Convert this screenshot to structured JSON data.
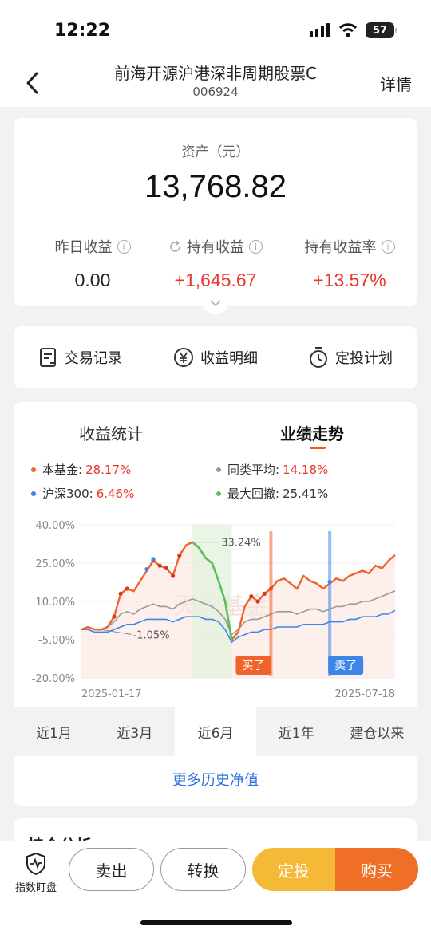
{
  "status_bar": {
    "time": "12:22",
    "battery": "57"
  },
  "header": {
    "title": "前海开源沪港深非周期股票C",
    "code": "006924",
    "detail": "详情"
  },
  "asset": {
    "label": "资产（元）",
    "amount": "13,768.82",
    "stats": [
      {
        "label": "昨日收益",
        "value": "0.00"
      },
      {
        "label": "持有收益",
        "value": "+1,645.67"
      },
      {
        "label": "持有收益率",
        "value": "+13.57%"
      }
    ]
  },
  "actions": [
    {
      "label": "交易记录",
      "icon": "record-icon"
    },
    {
      "label": "收益明细",
      "icon": "yen-icon"
    },
    {
      "label": "定投计划",
      "icon": "timer-icon"
    }
  ],
  "chart_section": {
    "tab_stats": "收益统计",
    "tab_trend": "业绩走势",
    "legend": [
      {
        "name": "本基金:",
        "value": "28.17%",
        "color": "#f0632a",
        "value_color": "#e8372c"
      },
      {
        "name": "同类平均:",
        "value": "14.18%",
        "color": "#999999",
        "value_color": "#e8372c"
      },
      {
        "name": "沪深300:",
        "value": "6.46%",
        "color": "#3d86e8",
        "value_color": "#e8372c"
      },
      {
        "name": "最大回撤:",
        "value": "25.41%",
        "color": "#5cc15c",
        "value_color": "#333333"
      }
    ],
    "watermark": "天天基金",
    "buy_tag": "买了",
    "sell_tag": "卖了",
    "periods": [
      "近1月",
      "近3月",
      "近6月",
      "近1年",
      "建仓以来"
    ],
    "active_period": "近6月",
    "more_link": "更多历史净值"
  },
  "partial_section": {
    "title": "持仓分析"
  },
  "bottom_bar": {
    "watch": "指数盯盘",
    "sell": "卖出",
    "convert": "转换",
    "invest": "定投",
    "buy": "购买"
  },
  "chart_data": {
    "type": "line",
    "x_start": "2025-01-17",
    "x_end": "2025-07-18",
    "ylim": [
      -20,
      40
    ],
    "yticks": [
      "40.00%",
      "25.00%",
      "10.00%",
      "-5.00%",
      "-20.00%"
    ],
    "annotations": [
      "33.24%",
      "-1.05%"
    ],
    "series": [
      {
        "name": "本基金",
        "color": "#f0632a",
        "values": [
          -1,
          0,
          -1,
          -1.05,
          0,
          4,
          13,
          15,
          14,
          18,
          22,
          26,
          24,
          23,
          20,
          28,
          32,
          33.24,
          31,
          27,
          25,
          18,
          10,
          -5,
          -2,
          8,
          12,
          10,
          13,
          15,
          18,
          19,
          17,
          15,
          20,
          18,
          17,
          15,
          17,
          19,
          18,
          20,
          21,
          22,
          21,
          24,
          23,
          26,
          28.17
        ]
      },
      {
        "name": "同类平均",
        "color": "#999999",
        "values": [
          -1,
          0,
          -1,
          -1,
          0,
          2,
          5,
          6,
          5,
          7,
          8,
          9,
          8,
          8,
          7,
          9,
          10,
          11,
          10,
          9,
          8,
          6,
          3,
          -3,
          -1,
          2,
          3,
          3,
          4,
          5,
          6,
          6,
          6,
          5,
          6,
          7,
          7,
          6,
          7,
          8,
          8,
          9,
          9,
          10,
          10,
          11,
          12,
          13,
          14.18
        ]
      },
      {
        "name": "沪深300",
        "color": "#3d86e8",
        "values": [
          -1,
          -1,
          -2,
          -2,
          -2,
          -1,
          0,
          1,
          1,
          2,
          3,
          3,
          3,
          3,
          2,
          3,
          4,
          4,
          4,
          3,
          3,
          2,
          -1,
          -6,
          -4,
          -3,
          -2,
          -2,
          -1,
          -1,
          0,
          0,
          0,
          0,
          1,
          1,
          1,
          1,
          2,
          2,
          2,
          3,
          3,
          4,
          4,
          4,
          5,
          5,
          6.46
        ]
      }
    ]
  }
}
